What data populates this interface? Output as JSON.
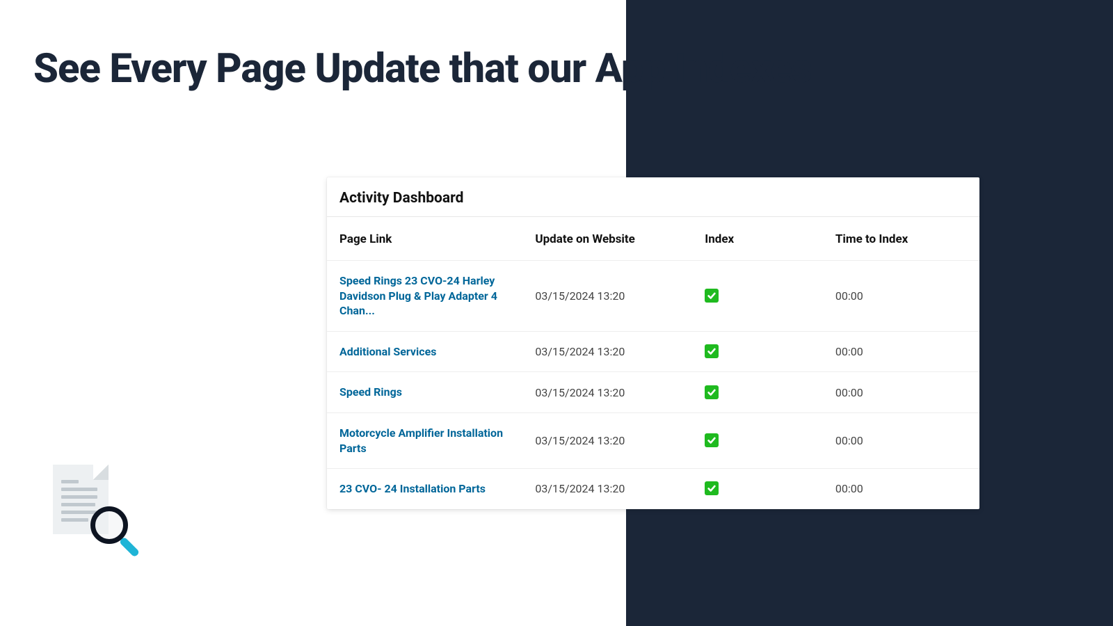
{
  "headline": "See Every Page Update that our App Indexes",
  "dashboard": {
    "title": "Activity Dashboard",
    "columns": {
      "page_link": "Page Link",
      "update_on_website": "Update on Website",
      "index": "Index",
      "time_to_index": "Time to Index"
    },
    "rows": [
      {
        "page_link": "Speed Rings 23 CVO-24 Harley Davidson Plug & Play Adapter 4 Chan...",
        "update": "03/15/2024 13:20",
        "indexed": true,
        "time_to_index": "00:00"
      },
      {
        "page_link": "Additional Services",
        "update": "03/15/2024 13:20",
        "indexed": true,
        "time_to_index": "00:00"
      },
      {
        "page_link": "Speed Rings",
        "update": "03/15/2024 13:20",
        "indexed": true,
        "time_to_index": "00:00"
      },
      {
        "page_link": "Motorcycle Amplifier Installation Parts",
        "update": "03/15/2024 13:20",
        "indexed": true,
        "time_to_index": "00:00"
      },
      {
        "page_link": "23 CVO- 24 Installation Parts",
        "update": "03/15/2024 13:20",
        "indexed": true,
        "time_to_index": "00:00"
      }
    ]
  }
}
